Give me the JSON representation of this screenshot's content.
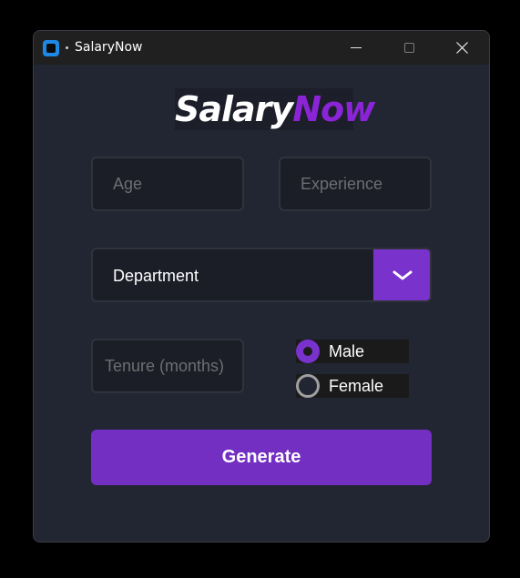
{
  "window": {
    "title": "SalaryNow",
    "icon": "app-window-icon"
  },
  "logo": {
    "part1": "Salary",
    "part2": "Now",
    "color_primary": "#ffffff",
    "color_accent": "#8a24d6"
  },
  "form": {
    "age": {
      "placeholder": "Age",
      "value": ""
    },
    "experience": {
      "placeholder": "Experience",
      "value": ""
    },
    "department": {
      "value": "Department",
      "icon": "chevron-down-icon"
    },
    "tenure": {
      "placeholder": "Tenure (months)",
      "value": ""
    },
    "gender": {
      "options": [
        {
          "label": "Male",
          "selected": true
        },
        {
          "label": "Female",
          "selected": false
        }
      ]
    },
    "generate_label": "Generate"
  },
  "colors": {
    "accent": "#722fc2",
    "background": "#222633",
    "field_background": "#1c1e27",
    "field_border": "#30333c"
  }
}
